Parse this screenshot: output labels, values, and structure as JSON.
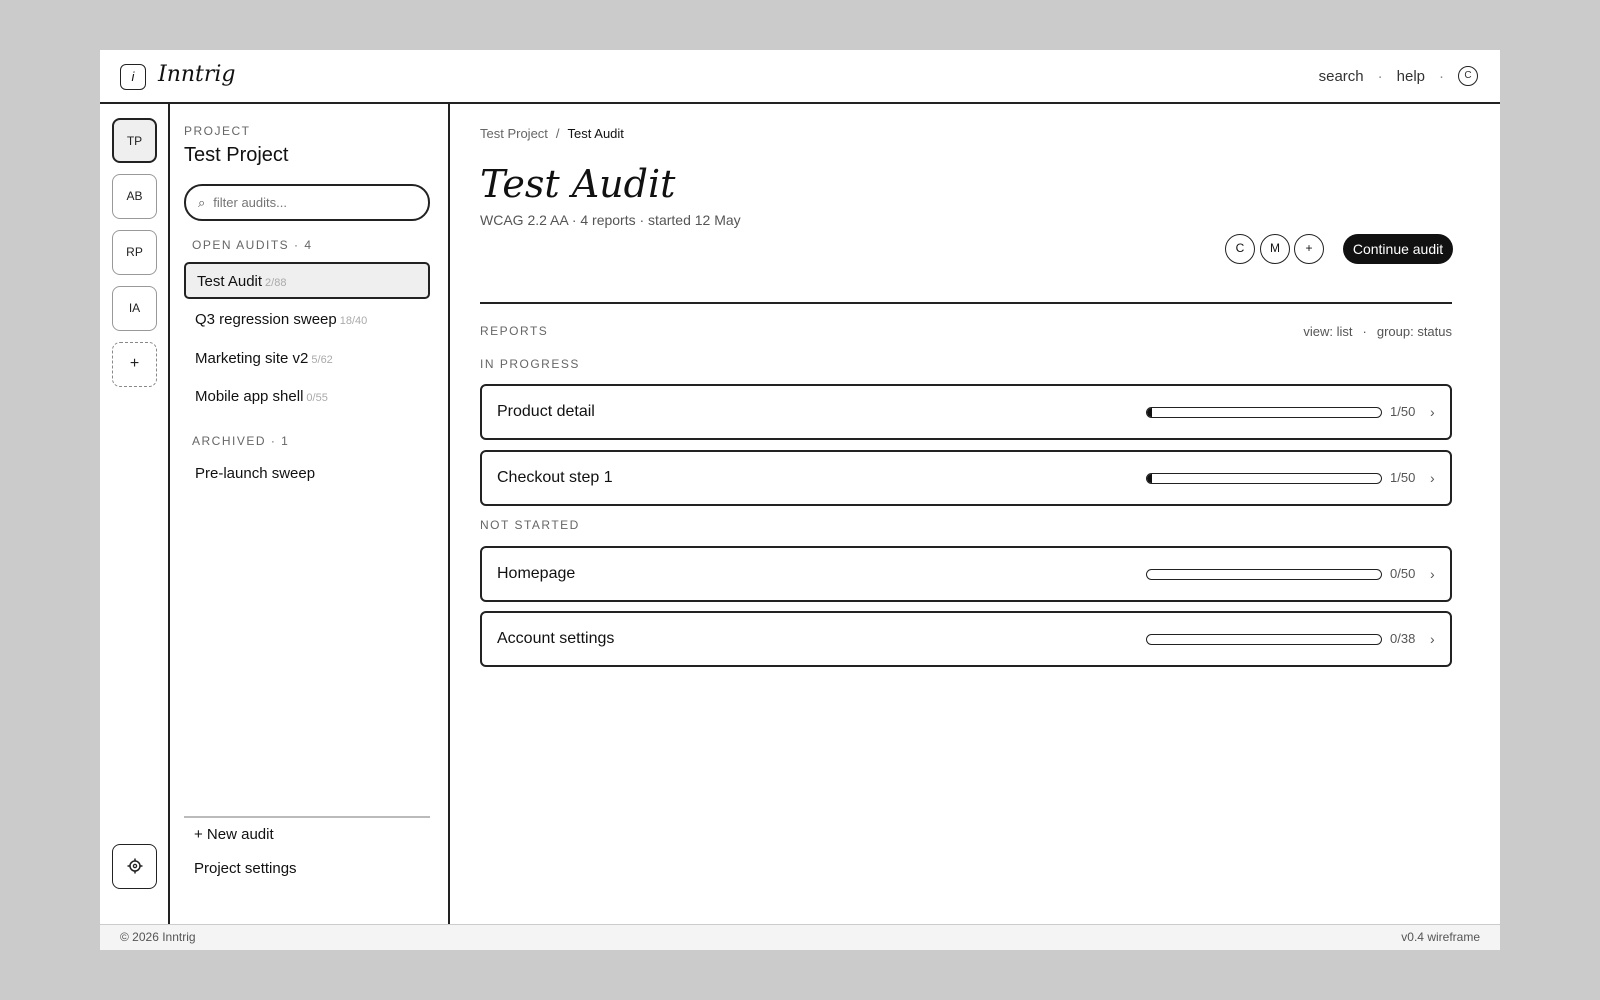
{
  "app": {
    "logo_glyph": "i",
    "name": "Inntrig"
  },
  "topnav": {
    "search": "search",
    "sep1": "·",
    "help": "help",
    "sep2": "·",
    "avatar": "C"
  },
  "rail": {
    "items": [
      {
        "label": "TP",
        "active": true
      },
      {
        "label": "AB"
      },
      {
        "label": "RP"
      },
      {
        "label": "IA"
      }
    ],
    "add_label": "+",
    "settings_icon": "gear-icon"
  },
  "sidebar": {
    "eyebrow": "PROJECT",
    "project_name": "Test Project",
    "filter_placeholder": "filter audits...",
    "open_label": "OPEN AUDITS · 4",
    "audits": [
      {
        "name": "Test Audit",
        "count": "2/88",
        "active": true
      },
      {
        "name": "Q3 regression sweep",
        "count": "18/40"
      },
      {
        "name": "Marketing site v2",
        "count": "5/62"
      },
      {
        "name": "Mobile app shell",
        "count": "0/55"
      }
    ],
    "archived_label": "ARCHIVED · 1",
    "archived": [
      {
        "name": "Pre-launch sweep"
      }
    ],
    "new_audit": "+ New audit",
    "project_settings": "Project settings"
  },
  "main": {
    "breadcrumb": {
      "parent": "Test Project",
      "sep": "/",
      "current": "Test Audit"
    },
    "title": "Test Audit",
    "subtitle": "WCAG 2.2 AA · 4 reports · started 12 May",
    "collaborators": [
      "C",
      "M"
    ],
    "add_collaborator": "+",
    "continue_label": "Continue audit",
    "reports_label": "REPORTS",
    "view_label": "view: list",
    "view_sep": "·",
    "group_label": "group: status",
    "groups": [
      {
        "label": "IN PROGRESS",
        "reports": [
          {
            "name": "Product detail",
            "done": 1,
            "total": 50,
            "count": "1/50"
          },
          {
            "name": "Checkout step 1",
            "done": 1,
            "total": 50,
            "count": "1/50"
          }
        ]
      },
      {
        "label": "NOT STARTED",
        "reports": [
          {
            "name": "Homepage",
            "done": 0,
            "total": 50,
            "count": "0/50"
          },
          {
            "name": "Account settings",
            "done": 0,
            "total": 38,
            "count": "0/38"
          }
        ]
      }
    ],
    "chevron": "›"
  },
  "footer": {
    "copyright": "© 2026 Inntrig",
    "version": "v0.4 wireframe"
  }
}
